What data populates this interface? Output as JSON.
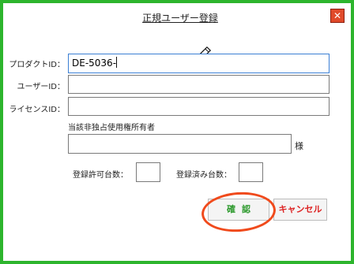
{
  "window": {
    "title": "正規ユーザー登録",
    "close_glyph": "✕"
  },
  "form": {
    "product_id_label": "プロダクトID：",
    "product_id_value": "DE-5036-",
    "user_id_label": "ユーザーID：",
    "user_id_value": "",
    "license_id_label": "ライセンスID：",
    "license_id_value": "",
    "holder_label": "当該非独占使用権所有者",
    "holder_value": "",
    "holder_suffix": "様",
    "allowed_count_label": "登録許可台数：",
    "allowed_count_value": "",
    "registered_count_label": "登録済み台数：",
    "registered_count_value": ""
  },
  "buttons": {
    "confirm_label": "確認",
    "cancel_label": "キャンセル"
  },
  "colors": {
    "frame": "#2db52d",
    "close": "#e04a2a",
    "highlight": "#f04a1c",
    "confirm_text": "#2e9a2e",
    "cancel_text": "#dd2222"
  },
  "icons": {
    "cursor_icon": "pencil-icon"
  }
}
